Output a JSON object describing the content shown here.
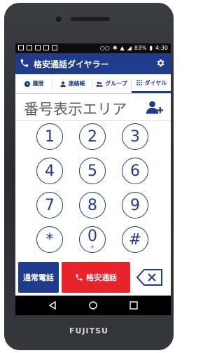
{
  "device": {
    "brand": "FUJITSU"
  },
  "status_bar": {
    "battery": "83%",
    "time": "4:30"
  },
  "app": {
    "title": "格安通話ダイヤラー"
  },
  "tabs": [
    {
      "label": "履歴",
      "icon": "clock-icon"
    },
    {
      "label": "連絡帳",
      "icon": "person-icon"
    },
    {
      "label": "グループ",
      "icon": "group-icon"
    },
    {
      "label": "ダイヤル",
      "icon": "dialpad-icon",
      "active": true
    }
  ],
  "display": {
    "placeholder": "番号表示エリア"
  },
  "keypad": {
    "keys": [
      "1",
      "2",
      "3",
      "4",
      "5",
      "6",
      "7",
      "8",
      "9",
      "*",
      "0",
      "#"
    ],
    "zero_sub": "+"
  },
  "actions": {
    "normal_call": "通常電話",
    "cheap_call": "格安通話"
  },
  "colors": {
    "primary": "#1f3c8c",
    "cheap_call": "#e8232b"
  }
}
